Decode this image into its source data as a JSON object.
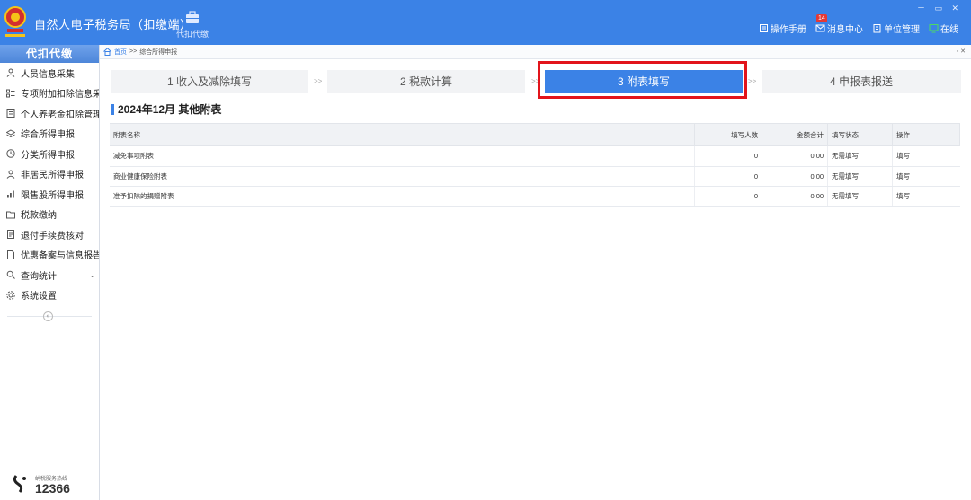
{
  "app": {
    "title": "自然人电子税务局（扣缴端）",
    "module_label": "代扣代缴",
    "window_controls": "－ ▭ ✕",
    "links": {
      "manual": "操作手册",
      "messages": "消息中心",
      "messages_badge": "14",
      "unit_mgmt": "单位管理",
      "online": "在线"
    },
    "brand_color": "#3b82e6"
  },
  "sidebar": {
    "header": "代扣代缴",
    "items": [
      {
        "label": "人员信息采集",
        "icon": "person-icon"
      },
      {
        "label": "专项附加扣除信息采集",
        "icon": "list-icon"
      },
      {
        "label": "个人养老金扣除管理",
        "icon": "doc-icon"
      },
      {
        "label": "综合所得申报",
        "icon": "layers-icon"
      },
      {
        "label": "分类所得申报",
        "icon": "clock-icon"
      },
      {
        "label": "非居民所得申报",
        "icon": "person-icon"
      },
      {
        "label": "限售股所得申报",
        "icon": "chart-icon"
      },
      {
        "label": "税款缴纳",
        "icon": "folder-icon"
      },
      {
        "label": "退付手续费核对",
        "icon": "receipt-icon"
      },
      {
        "label": "优惠备案与信息报告",
        "icon": "doc-icon",
        "expandable": true
      },
      {
        "label": "查询统计",
        "icon": "search-icon",
        "expandable": true
      },
      {
        "label": "系统设置",
        "icon": "gear-icon"
      }
    ],
    "collapse_glyph": "«",
    "hotline_caption": "纳税服务热线",
    "hotline_number": "12366"
  },
  "breadcrumb": {
    "home": "首页",
    "separator": ">>",
    "current": "综合所得申报"
  },
  "steps": [
    {
      "label": "1 收入及减除填写",
      "active": false
    },
    {
      "label": "2 税款计算",
      "active": false
    },
    {
      "label": "3 附表填写",
      "active": true
    },
    {
      "label": "4 申报表报送",
      "active": false
    }
  ],
  "step_separator": ">>",
  "section_title": "2024年12月 其他附表",
  "table": {
    "headers": [
      "附表名称",
      "填写人数",
      "金额合计",
      "填写状态",
      "操作"
    ],
    "rows": [
      {
        "name": "减免事项附表",
        "count": "0",
        "amount": "0.00",
        "status": "无需填写",
        "action": "填写"
      },
      {
        "name": "商业健康保险附表",
        "count": "0",
        "amount": "0.00",
        "status": "无需填写",
        "action": "填写"
      },
      {
        "name": "准予扣除的捐赠附表",
        "count": "0",
        "amount": "0.00",
        "status": "无需填写",
        "action": "填写"
      }
    ]
  }
}
